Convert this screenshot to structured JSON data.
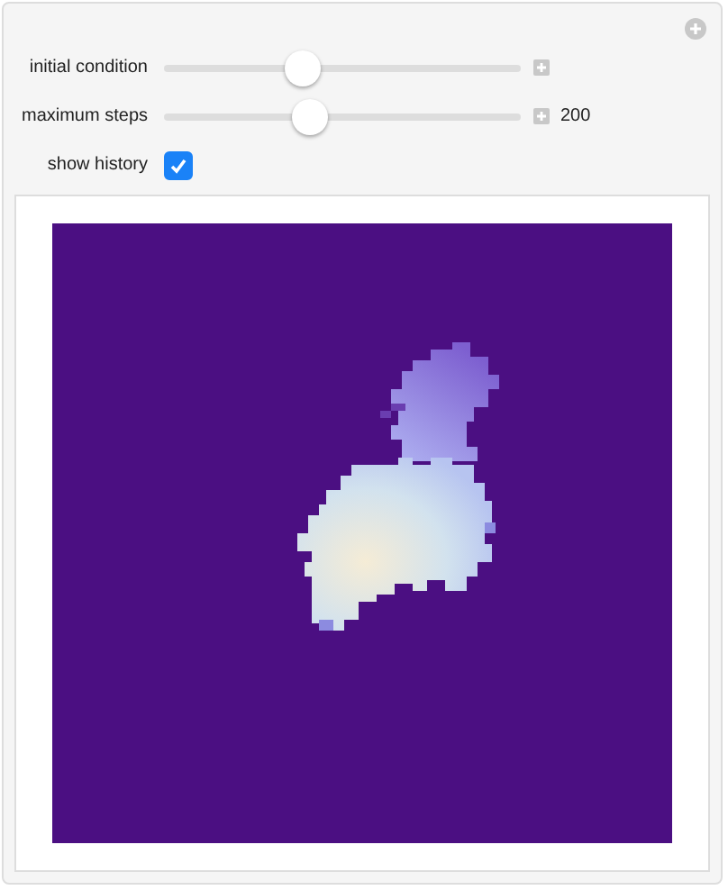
{
  "controls": [
    {
      "kind": "slider",
      "label": "initial condition",
      "level": 0.39
    },
    {
      "kind": "slider",
      "label": "maximum steps",
      "level": 0.41,
      "reading": "200"
    },
    {
      "kind": "checkbox",
      "label": "show history",
      "checked": true
    }
  ]
}
